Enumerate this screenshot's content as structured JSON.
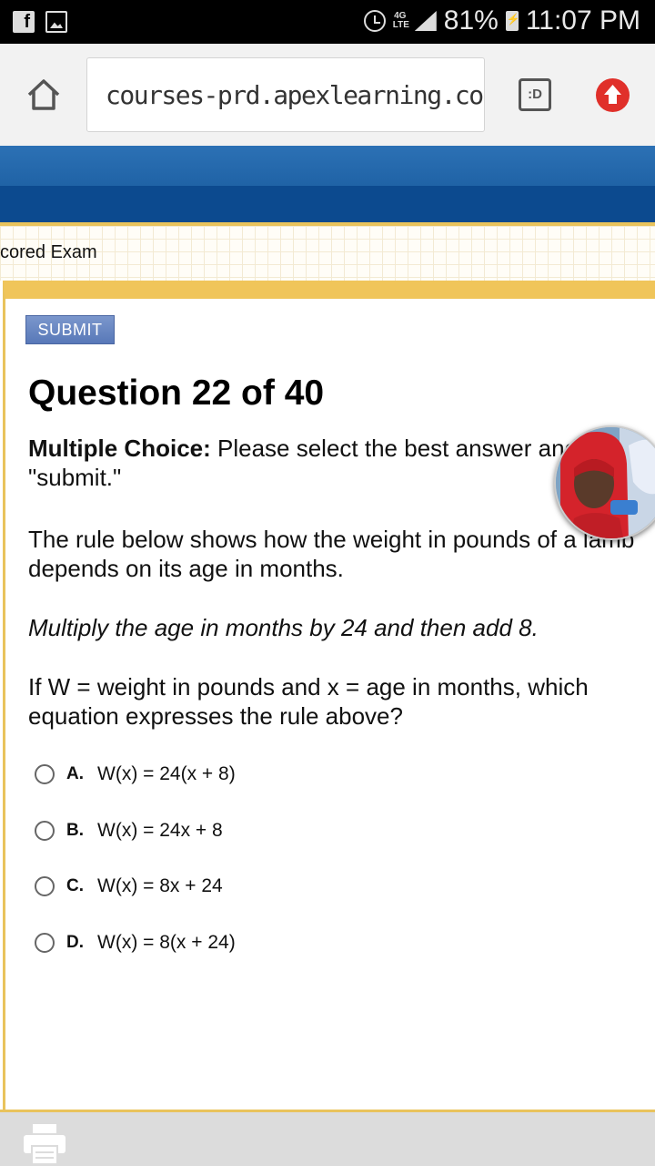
{
  "status_bar": {
    "battery": "81%",
    "network": "4G\nLTE",
    "time": "11:07 PM",
    "icons": [
      "facebook-icon",
      "gallery-icon",
      "alarm-icon",
      "lte-icon",
      "signal-icon",
      "battery-charging-icon"
    ]
  },
  "browser": {
    "url": "courses-prd.apexlearning.com/",
    "tab_switcher_label": ":D",
    "icons": [
      "home-icon",
      "tab-switcher-icon",
      "upload-icon"
    ]
  },
  "page": {
    "breadcrumb": "cored Exam",
    "submit_label": "SUBMIT",
    "question_title": "Question 22 of 40",
    "instructions_label": "Multiple Choice:",
    "instructions_text_line1": " Please select the best answer and click",
    "instructions_text_line2": "\"submit.\"",
    "stem_line1": "The rule below shows how the weight in pounds of a lamb",
    "stem_line2": "depends on its age in months.",
    "rule": "Multiply the age in months by 24 and then add 8.",
    "question_line1": "If W = weight in pounds and x = age in months, which",
    "question_line2": "equation expresses the rule above?",
    "options": [
      {
        "letter": "A.",
        "text": "W(x) = 24(x + 8)"
      },
      {
        "letter": "B.",
        "text": "W(x) = 24x + 8"
      },
      {
        "letter": "C.",
        "text": "W(x) = 8x + 24"
      },
      {
        "letter": "D.",
        "text": "W(x) = 8(x + 24)"
      }
    ]
  },
  "colors": {
    "accent_gold": "#f0c55a",
    "header_blue": "#1f62a5",
    "submit_blue": "#6a88c2",
    "upload_red": "#e0302a"
  }
}
